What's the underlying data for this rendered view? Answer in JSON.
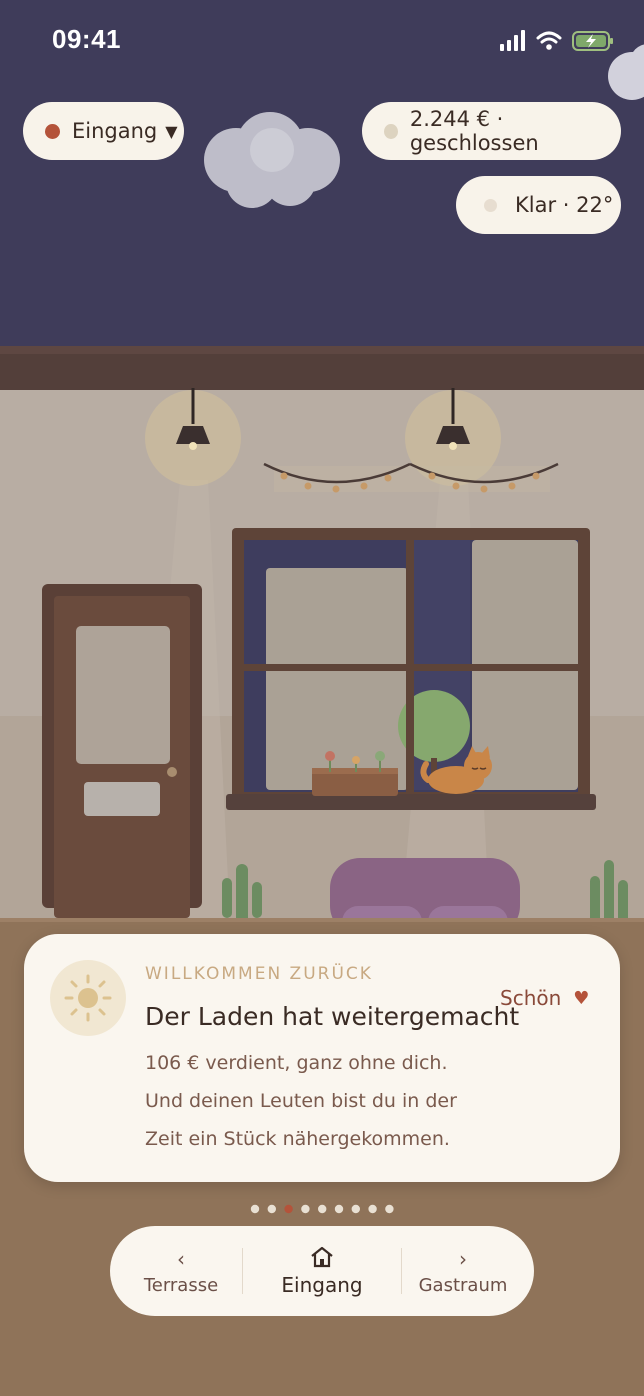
{
  "status_bar": {
    "time": "09:41"
  },
  "top_bar": {
    "location_label": "Eingang",
    "location_dropdown_icon": "caret-down-icon",
    "money_status": "2.244 € · geschlossen",
    "weather": "Klar · 22°"
  },
  "scene": {
    "description_icons": [
      "lamp-icon",
      "lamp-icon",
      "door-icon",
      "window-icon",
      "cat-icon",
      "sofa-icon",
      "cactus-icon",
      "plant-icon"
    ]
  },
  "notification": {
    "eyebrow": "WILLKOMMEN ZURÜCK",
    "title": "Der Laden hat weitergemacht",
    "body_line1": "106 € verdient, ganz ohne dich.",
    "body_line2": "Und deinen Leuten bist du in der",
    "body_line3": "Zeit ein Stück nähergekommen.",
    "action_label": "Schön",
    "action_icon": "heart-icon"
  },
  "pager": {
    "count": 9,
    "active_index": 2
  },
  "bottom_nav": {
    "left_label": "Terrasse",
    "left_arrow": "‹",
    "center_label": "Eingang",
    "right_label": "Gastraum",
    "right_arrow": "›"
  },
  "colors": {
    "sky": "#3f3c5a",
    "card": "#faf6ef",
    "accent": "#b4533a",
    "eyebrow": "#c8a982"
  }
}
